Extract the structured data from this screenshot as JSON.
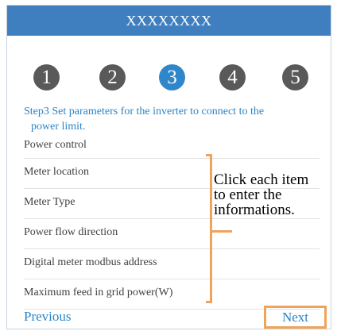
{
  "header": {
    "title": "XXXXXXXX"
  },
  "steps": [
    {
      "label": "1",
      "active": false
    },
    {
      "label": "2",
      "active": false
    },
    {
      "label": "3",
      "active": true
    },
    {
      "label": "4",
      "active": false
    },
    {
      "label": "5",
      "active": false
    }
  ],
  "instruction": {
    "line1": "Step3 Set parameters for the inverter to connect to the",
    "line2": "power limit."
  },
  "settings": {
    "items": [
      {
        "label": "Power control"
      },
      {
        "label": "Meter location"
      },
      {
        "label": "Meter Type"
      },
      {
        "label": "Power flow direction"
      },
      {
        "label": "Digital meter modbus address"
      },
      {
        "label": "Maximum feed in grid power(W)"
      }
    ]
  },
  "annotation": {
    "line1": "Click each item",
    "line2": "to enter the",
    "line3": "informations."
  },
  "footer": {
    "previous_label": "Previous",
    "next_label": "Next"
  },
  "colors": {
    "header": "#3f7fbf",
    "accent_blue": "#2a84c6",
    "active_step": "#2f86c9",
    "inactive_step": "#595959",
    "highlight_orange": "#f0a35b"
  }
}
